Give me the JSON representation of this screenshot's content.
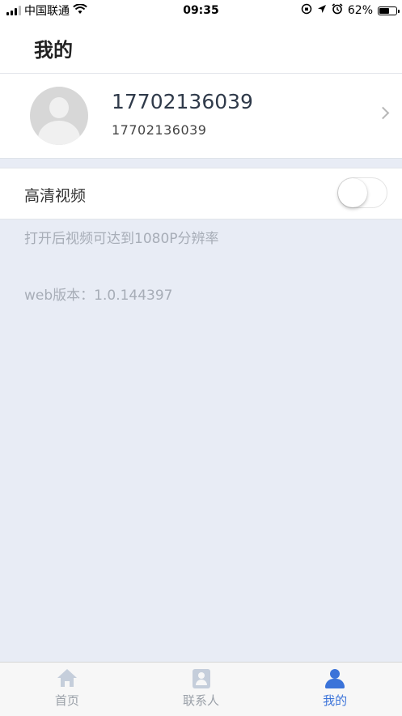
{
  "status_bar": {
    "carrier": "中国联通",
    "time": "09:35",
    "battery": "62%",
    "battery_level": 0.62,
    "icons": [
      "signal-icon",
      "wifi-icon",
      "rotation-lock-icon",
      "location-icon",
      "alarm-icon",
      "battery-icon"
    ]
  },
  "header": {
    "title": "我的"
  },
  "profile": {
    "name": "17702136039",
    "subtitle": "17702136039",
    "avatar_icon": "default-avatar-icon",
    "chevron_icon": "chevron-right-icon"
  },
  "settings": {
    "hd_video_label": "高清视频",
    "hd_video_enabled": false,
    "hint": "打开后视频可达到1080P分辨率",
    "version": "web版本：1.0.144397"
  },
  "tabbar": {
    "tabs": [
      {
        "label": "首页",
        "icon": "home-icon",
        "active": false
      },
      {
        "label": "联系人",
        "icon": "contacts-icon",
        "active": false
      },
      {
        "label": "我的",
        "icon": "user-icon",
        "active": true
      }
    ]
  },
  "colors": {
    "accent": "#3b73d9",
    "page_background": "#e8ecf5",
    "muted_text": "#a7adb7",
    "inactive_icon": "#c5cedb"
  }
}
